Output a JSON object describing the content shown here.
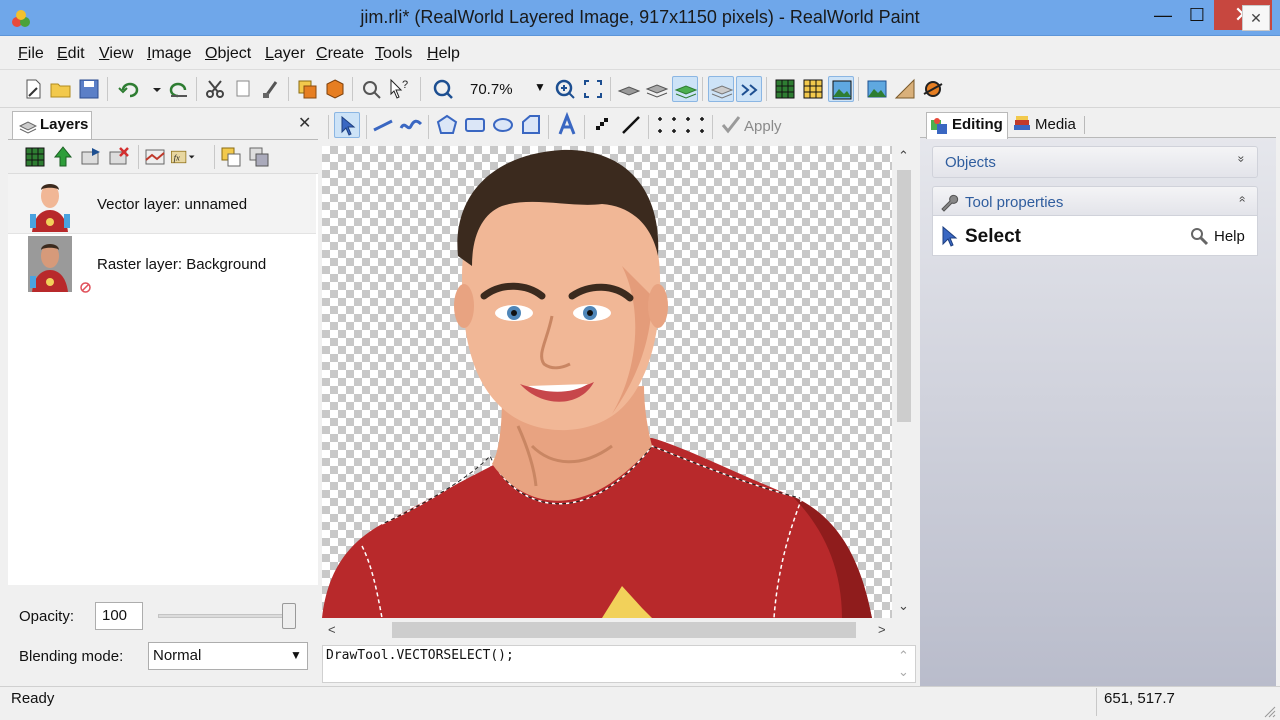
{
  "window": {
    "title": "jim.rli* (RealWorld Layered Image, 917x1150 pixels) - RealWorld Paint",
    "minimize": "—",
    "maximize": "☐",
    "close": "✕"
  },
  "menu": {
    "items": [
      {
        "label": "File",
        "accel": "F",
        "rest": "ile"
      },
      {
        "label": "Edit",
        "accel": "E",
        "rest": "dit"
      },
      {
        "label": "View",
        "accel": "V",
        "rest": "iew"
      },
      {
        "label": "Image",
        "accel": "I",
        "rest": "mage"
      },
      {
        "label": "Object",
        "accel": "O",
        "rest": "bject"
      },
      {
        "label": "Layer",
        "accel": "L",
        "rest": "ayer"
      },
      {
        "label": "Create",
        "accel": "C",
        "rest": "reate"
      },
      {
        "label": "Tools",
        "accel": "T",
        "rest": "ools"
      },
      {
        "label": "Help",
        "accel": "H",
        "rest": "elp"
      }
    ],
    "mdi_close": "✕"
  },
  "toolbar": {
    "zoom_value": "70.7%",
    "zoom_arrow": "▼"
  },
  "layers_panel": {
    "tab_label": "Layers",
    "close": "✕",
    "layers": [
      {
        "name": "Vector layer: unnamed",
        "selected": true
      },
      {
        "name": "Raster layer: Background",
        "selected": false
      }
    ],
    "opacity_label": "Opacity:",
    "opacity_value": "100",
    "opacity_level": 1.0,
    "blend_label": "Blending mode:",
    "blend_value": "Normal",
    "blend_arrow": "▼"
  },
  "draw_toolbar": {
    "apply_label": "Apply"
  },
  "canvas": {
    "scroll_up": "⌃",
    "scroll_down": "⌄",
    "scroll_left": "<",
    "scroll_right": ">"
  },
  "console": {
    "text": "DrawTool.VECTORSELECT();",
    "up": "⌃",
    "down": "⌄"
  },
  "right_panel": {
    "tabs": [
      {
        "label": "Editing",
        "active": true
      },
      {
        "label": "Media",
        "active": false
      }
    ],
    "objects_label": "Objects",
    "objects_chevron": "»",
    "toolprops_label": "Tool properties",
    "toolprops_chevron": "»",
    "tool_name": "Select",
    "help_label": "Help"
  },
  "status": {
    "text": "Ready",
    "coords": "651, 517.7"
  },
  "colors": {
    "titlebar": "#6fa7ea",
    "close": "#c7473f",
    "link": "#2f5d9e",
    "shirt": "#b8292b"
  }
}
